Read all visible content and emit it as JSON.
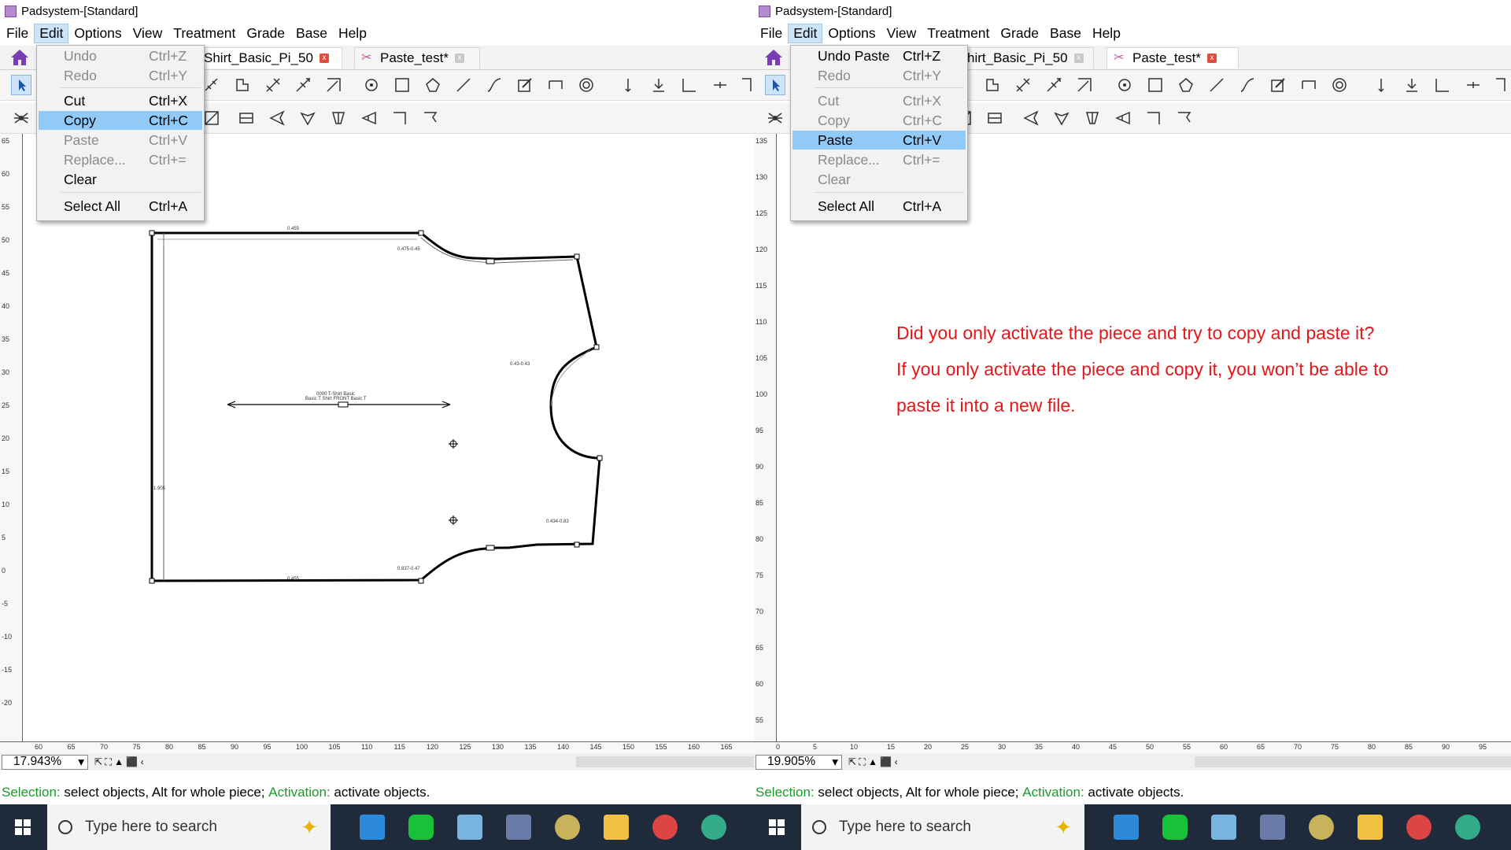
{
  "panes": [
    {
      "title": "Padsystem-[Standard]",
      "menus": [
        "File",
        "Edit",
        "Options",
        "View",
        "Treatment",
        "Grade",
        "Base",
        "Help"
      ],
      "tabs": [
        {
          "label": "Shirt_Basic_Pi_50",
          "close": "x"
        },
        {
          "label": "Paste_test*",
          "close": "x"
        }
      ],
      "edit_menu": [
        {
          "label": "Undo",
          "shortcut": "Ctrl+Z"
        },
        {
          "label": "Redo",
          "shortcut": "Ctrl+Y"
        },
        {
          "label": "Cut",
          "shortcut": "Ctrl+X"
        },
        {
          "label": "Copy",
          "shortcut": "Ctrl+C"
        },
        {
          "label": "Paste",
          "shortcut": "Ctrl+V"
        },
        {
          "label": "Replace...",
          "shortcut": "Ctrl+="
        },
        {
          "label": "Clear",
          "shortcut": ""
        },
        {
          "label": "Select All",
          "shortcut": "Ctrl+A"
        }
      ],
      "zoom": "17.943%",
      "status": {
        "sel_label": "Selection:",
        "sel_text": " select objects, Alt for whole piece; ",
        "act_label": "Activation:",
        "act_text": " activate objects."
      },
      "vruler_labels": [
        "65",
        "60",
        "55",
        "50",
        "45",
        "40",
        "35",
        "30",
        "25",
        "20",
        "15",
        "10",
        "5",
        "0",
        "-5",
        "-10",
        "-15",
        "-20"
      ],
      "hruler_labels": [
        "60",
        "65",
        "70",
        "75",
        "80",
        "85",
        "90",
        "95",
        "100",
        "105",
        "110",
        "115",
        "120",
        "125",
        "130",
        "135",
        "140",
        "145",
        "150",
        "155",
        "160",
        "165"
      ]
    },
    {
      "title": "Padsystem-[Standard]",
      "menus": [
        "File",
        "Edit",
        "Options",
        "View",
        "Treatment",
        "Grade",
        "Base",
        "Help"
      ],
      "tabs": [
        {
          "label": "hirt_Basic_Pi_50",
          "close": "x"
        },
        {
          "label": "Paste_test*",
          "close": "x"
        }
      ],
      "edit_menu": [
        {
          "label": "Undo Paste",
          "shortcut": "Ctrl+Z"
        },
        {
          "label": "Redo",
          "shortcut": "Ctrl+Y"
        },
        {
          "label": "Cut",
          "shortcut": "Ctrl+X"
        },
        {
          "label": "Copy",
          "shortcut": "Ctrl+C"
        },
        {
          "label": "Paste",
          "shortcut": "Ctrl+V"
        },
        {
          "label": "Replace...",
          "shortcut": "Ctrl+="
        },
        {
          "label": "Clear",
          "shortcut": ""
        },
        {
          "label": "Select All",
          "shortcut": "Ctrl+A"
        }
      ],
      "zoom": "19.905%",
      "status": {
        "sel_label": "Selection:",
        "sel_text": " select objects, Alt for whole piece; ",
        "act_label": "Activation:",
        "act_text": " activate objects."
      },
      "vruler_labels": [
        "135",
        "130",
        "125",
        "120",
        "115",
        "110",
        "105",
        "100",
        "95",
        "90",
        "85",
        "80",
        "75",
        "70",
        "65",
        "60",
        "55"
      ],
      "hruler_labels": [
        "0",
        "5",
        "10",
        "15",
        "20",
        "25",
        "30",
        "35",
        "40",
        "45",
        "50",
        "55",
        "60",
        "65",
        "70",
        "75",
        "80",
        "85",
        "90",
        "95"
      ],
      "note": [
        "Did you only activate the piece and try to copy and paste it?",
        "If you only activate the piece and copy it, you won’t be able to",
        "paste it into a new file."
      ]
    }
  ],
  "taskbar": {
    "search_placeholder": "Type here to search"
  },
  "piece_labels": {
    "top": "0.455",
    "neck": "0.475-0.45",
    "arm1": "0.43-0.43",
    "arm2": "0.434-0.83",
    "neck2": "0.837-0.47",
    "bottom": "0.455",
    "left": "1.905",
    "center1": "0000 T-Shirt Basic",
    "center2": "Basic T Shirt FRONT Basic T"
  },
  "colors": {
    "accent": "#91c9f7",
    "note": "#e4181b",
    "status_label": "#1a9a2a",
    "taskbar": "#1f2b3a"
  }
}
